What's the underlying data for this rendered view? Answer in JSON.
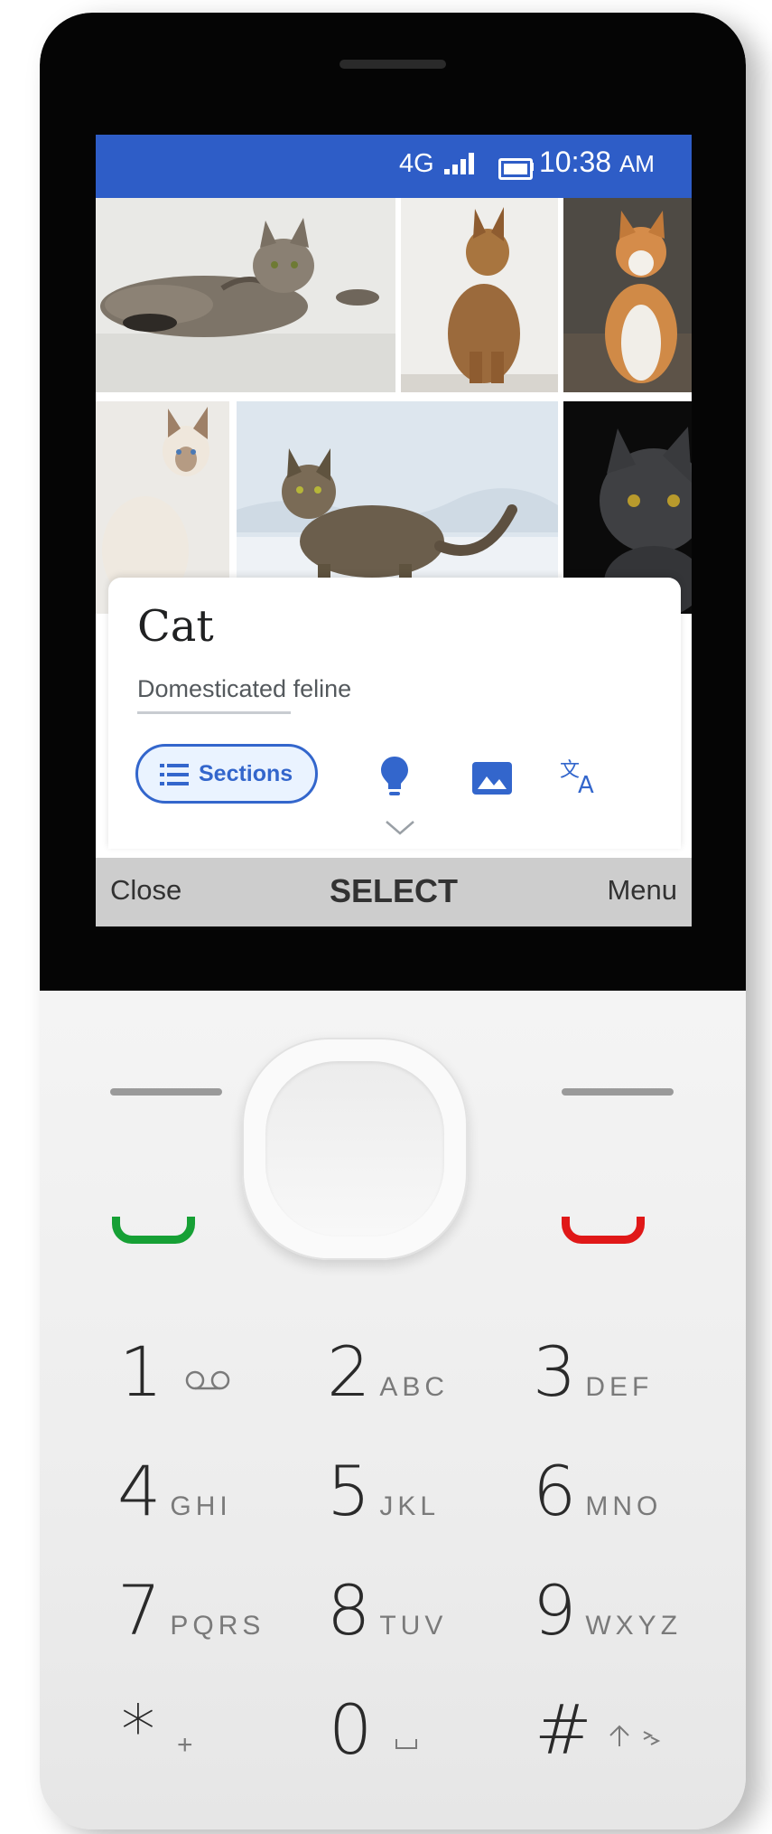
{
  "status_bar": {
    "network": "4G",
    "time": "10:38",
    "ampm": "AM"
  },
  "article": {
    "title": "Cat",
    "description": "Domesticated feline"
  },
  "actions": {
    "sections_label": "Sections"
  },
  "softkeys": {
    "left": "Close",
    "center": "SELECT",
    "right": "Menu"
  },
  "keypad": [
    {
      "num": "1",
      "letters": ""
    },
    {
      "num": "2",
      "letters": "ABC"
    },
    {
      "num": "3",
      "letters": "DEF"
    },
    {
      "num": "4",
      "letters": "GHI"
    },
    {
      "num": "5",
      "letters": "JKL"
    },
    {
      "num": "6",
      "letters": "MNO"
    },
    {
      "num": "7",
      "letters": "PQRS"
    },
    {
      "num": "8",
      "letters": "TUV"
    },
    {
      "num": "9",
      "letters": "WXYZ"
    },
    {
      "num": "*",
      "letters": "+"
    },
    {
      "num": "0",
      "letters": ""
    },
    {
      "num": "#",
      "letters": ""
    }
  ],
  "colors": {
    "accent": "#3366cc",
    "status_bar": "#2e5dc7",
    "call_green": "#16a035",
    "end_red": "#e01818"
  }
}
